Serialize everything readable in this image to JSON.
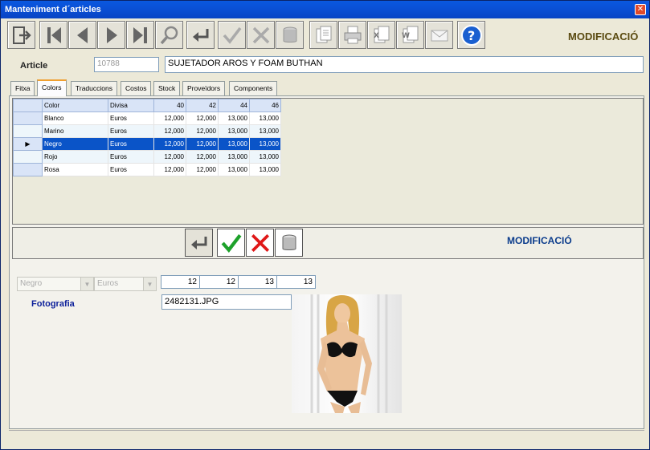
{
  "window": {
    "title": "Manteniment d´articles",
    "close_glyph": "✕"
  },
  "toolbar": {
    "buttons": [
      {
        "name": "exit-icon"
      },
      {
        "name": "first-record-icon"
      },
      {
        "name": "previous-record-icon"
      },
      {
        "name": "next-record-icon"
      },
      {
        "name": "last-record-icon"
      },
      {
        "name": "search-icon"
      },
      {
        "name": "return-icon"
      },
      {
        "name": "confirm-icon"
      },
      {
        "name": "cancel-icon"
      },
      {
        "name": "delete-icon"
      },
      {
        "name": "report-icon"
      },
      {
        "name": "print-icon"
      },
      {
        "name": "excel-icon"
      },
      {
        "name": "word-icon"
      },
      {
        "name": "email-icon"
      },
      {
        "name": "help-icon"
      }
    ],
    "mode": "MODIFICACIÓ"
  },
  "article": {
    "label": "Article",
    "code": "10788",
    "description": "SUJETADOR AROS Y FOAM BUTHAN"
  },
  "tabs": [
    {
      "label": "Fitxa"
    },
    {
      "label": "Colors"
    },
    {
      "label": "Traduccions"
    },
    {
      "label": "Costos"
    },
    {
      "label": "Stock"
    },
    {
      "label": "Proveïdors"
    },
    {
      "label": "Components"
    }
  ],
  "grid": {
    "columns": [
      "Color",
      "Divisa",
      "40",
      "42",
      "44",
      "46"
    ],
    "rows": [
      [
        "Blanco",
        "Euros",
        "12,000",
        "12,000",
        "13,000",
        "13,000"
      ],
      [
        "Marino",
        "Euros",
        "12,000",
        "12,000",
        "13,000",
        "13,000"
      ],
      [
        "Negro",
        "Euros",
        "12,000",
        "12,000",
        "13,000",
        "13,000"
      ],
      [
        "Rojo",
        "Euros",
        "12,000",
        "12,000",
        "13,000",
        "13,000"
      ],
      [
        "Rosa",
        "Euros",
        "12,000",
        "12,000",
        "13,000",
        "13,000"
      ]
    ],
    "selected_row": 2,
    "row_pointer": "▶"
  },
  "editbar": {
    "mode": "MODIFICACIÓ"
  },
  "edit": {
    "color": "Negro",
    "divisa": "Euros",
    "values": [
      "12",
      "12",
      "13",
      "13"
    ],
    "arrow": "▼"
  },
  "foto": {
    "label": "Fotografia",
    "filename": "2482131.JPG"
  },
  "colors": {
    "title_bar": "#0a50d0",
    "mode_toolbar": "#5a4a10",
    "mode_editbar": "#0b3c8c",
    "selected_row": "#0a54c8",
    "foto_label": "#0b1f9a"
  }
}
